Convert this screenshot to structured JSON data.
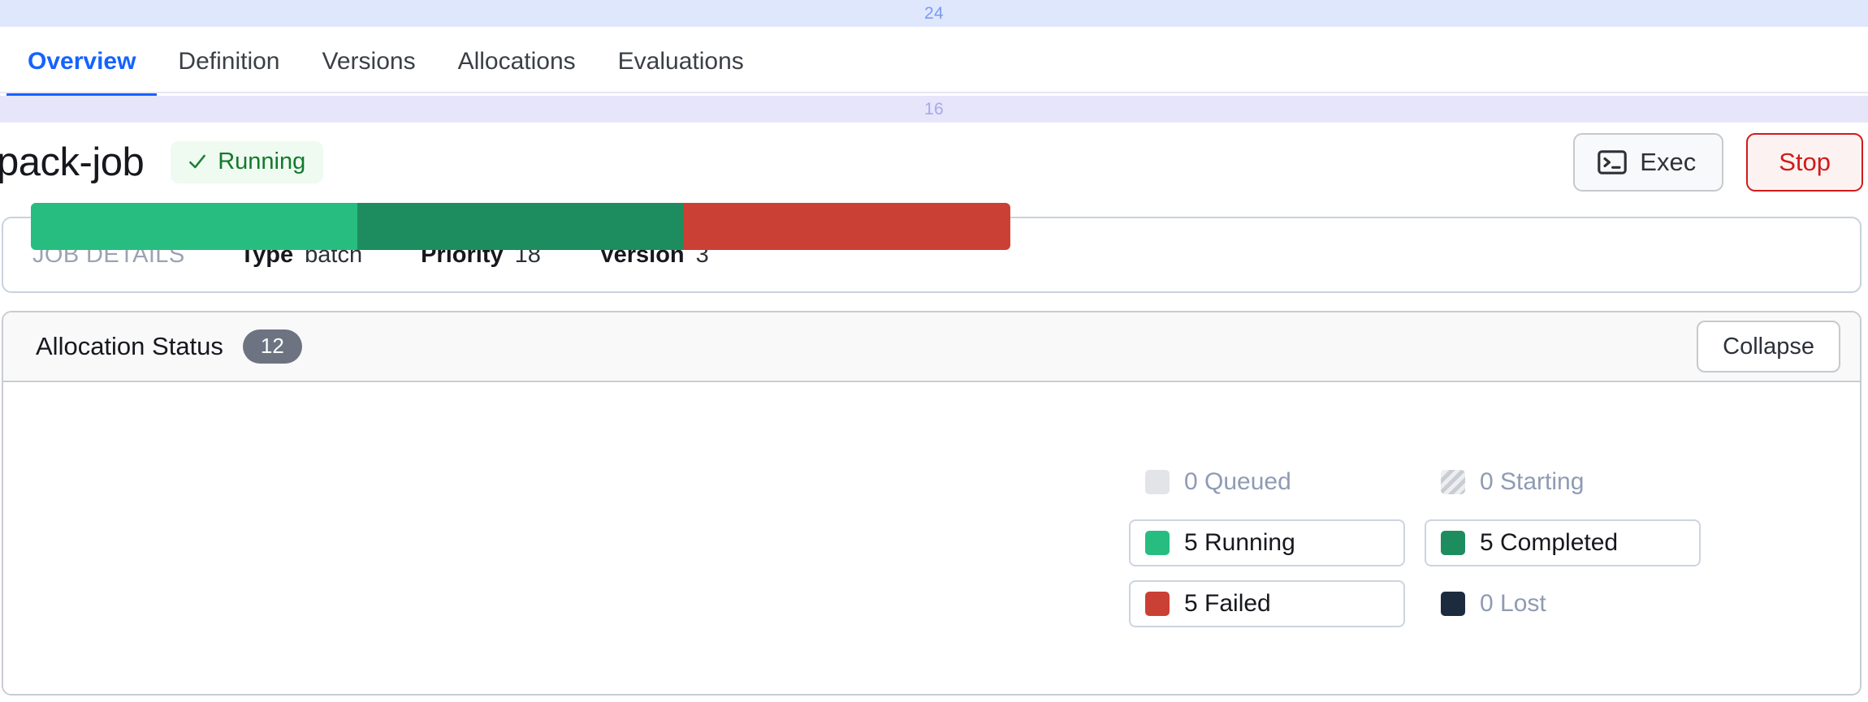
{
  "spacers": {
    "top_value": "24",
    "mid_value": "16"
  },
  "tabs": [
    {
      "label": "Overview",
      "active": true
    },
    {
      "label": "Definition",
      "active": false
    },
    {
      "label": "Versions",
      "active": false
    },
    {
      "label": "Allocations",
      "active": false
    },
    {
      "label": "Evaluations",
      "active": false
    }
  ],
  "job": {
    "title": "pack-job",
    "status": "Running",
    "status_color": "#137a2c",
    "status_bg": "#effaf1"
  },
  "actions": {
    "exec_label": "Exec",
    "stop_label": "Stop",
    "stop_color": "#d11b1b"
  },
  "job_details": {
    "section_label": "JOB DETAILS",
    "fields": [
      {
        "key": "Type",
        "value": "batch"
      },
      {
        "key": "Priority",
        "value": "18"
      },
      {
        "key": "Version",
        "value": "3"
      }
    ]
  },
  "allocation_status": {
    "title": "Allocation Status",
    "count": "12",
    "collapse_label": "Collapse"
  },
  "chart_data": {
    "type": "bar",
    "title": "Allocation Status",
    "orientation": "horizontal-stacked",
    "total": 12,
    "categories": [
      "Queued",
      "Starting",
      "Running",
      "Completed",
      "Failed",
      "Lost"
    ],
    "values": [
      0,
      0,
      5,
      5,
      5,
      0
    ],
    "colors": [
      "#e2e4e8",
      "#c9ccd2",
      "#27bd80",
      "#1d8d5f",
      "#cb4034",
      "#1d2b3f"
    ],
    "segments": [
      {
        "label": "Running",
        "value": 5,
        "color": "#27bd80",
        "width_pct": 33.33
      },
      {
        "label": "Completed",
        "value": 5,
        "color": "#1d8d5f",
        "width_pct": 33.33
      },
      {
        "label": "Failed",
        "value": 5,
        "color": "#cb4034",
        "width_pct": 33.34
      }
    ],
    "legend_position": "right",
    "grid": false,
    "xlabel": "",
    "ylabel": ""
  },
  "legend": [
    {
      "label": "0 Queued",
      "count": 0,
      "name": "Queued",
      "color": "#e2e4e8",
      "boxed": false,
      "muted": true,
      "striped": false
    },
    {
      "label": "0 Starting",
      "count": 0,
      "name": "Starting",
      "color": "#c9ccd2",
      "boxed": false,
      "muted": true,
      "striped": true
    },
    {
      "label": "5 Running",
      "count": 5,
      "name": "Running",
      "color": "#27bd80",
      "boxed": true,
      "muted": false,
      "striped": false
    },
    {
      "label": "5 Completed",
      "count": 5,
      "name": "Completed",
      "color": "#1d8d5f",
      "boxed": true,
      "muted": false,
      "striped": false
    },
    {
      "label": "5 Failed",
      "count": 5,
      "name": "Failed",
      "color": "#cb4034",
      "boxed": true,
      "muted": false,
      "striped": false
    },
    {
      "label": "0 Lost",
      "count": 0,
      "name": "Lost",
      "color": "#1d2b3f",
      "boxed": false,
      "muted": true,
      "striped": false
    }
  ]
}
